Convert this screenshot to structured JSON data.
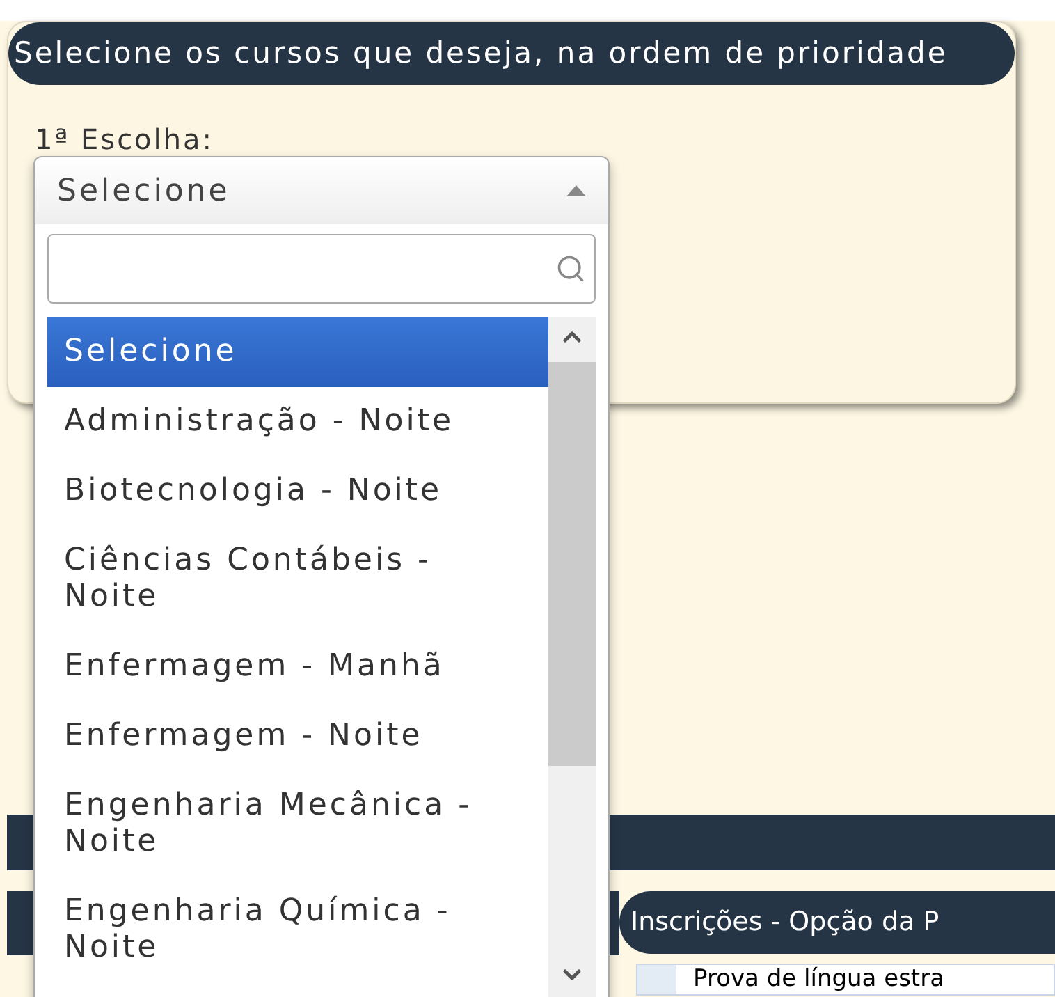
{
  "section": {
    "title": "Selecione os cursos que deseja, na ordem de prioridade",
    "field_label": "1ª Escolha:"
  },
  "select": {
    "value": "Selecione",
    "expanded": true,
    "options": [
      {
        "label": "Selecione",
        "selected": true
      },
      {
        "label": "Administração - Noite",
        "selected": false
      },
      {
        "label": "Biotecnologia - Noite",
        "selected": false
      },
      {
        "label": "Ciências Contábeis - Noite",
        "selected": false
      },
      {
        "label": "Enfermagem - Manhã",
        "selected": false
      },
      {
        "label": "Enfermagem - Noite",
        "selected": false
      },
      {
        "label": "Engenharia Mecânica - Noite",
        "selected": false
      },
      {
        "label": "Engenharia Química - Noite",
        "selected": false
      }
    ]
  },
  "lower_panel": {
    "title": "Inscrições - Opção da P",
    "row_text": "Prova de língua estra"
  }
}
